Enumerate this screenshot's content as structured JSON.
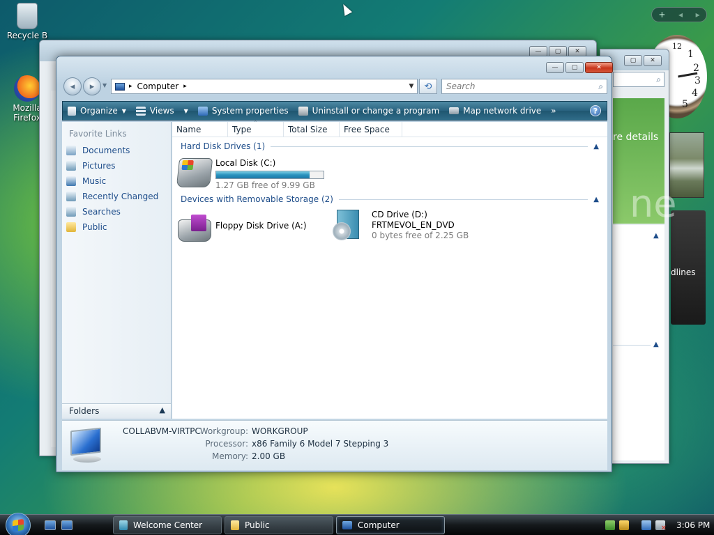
{
  "desktop": {
    "icons": [
      {
        "label": "Recycle B"
      },
      {
        "label": "Mozilla Firefox"
      }
    ]
  },
  "gadgets": {
    "controls": [
      "+",
      "◂",
      "▸"
    ],
    "clock_numbers": [
      "12",
      "1",
      "2",
      "3",
      "4",
      "5"
    ],
    "bg_texts": [
      "re details",
      "dlines",
      "ne"
    ]
  },
  "explorer": {
    "caption_buttons": {
      "minimize": "—",
      "maximize": "▢",
      "close": "✕"
    },
    "address": {
      "location": "Computer",
      "separator": "▸"
    },
    "search": {
      "placeholder": "Search",
      "icon": "search-icon"
    },
    "toolbar": [
      {
        "label": "Organize",
        "has_arrow": true
      },
      {
        "label": "Views",
        "has_arrow": true
      },
      {
        "label": "System properties"
      },
      {
        "label": "Uninstall or change a program"
      },
      {
        "label": "Map network drive"
      },
      {
        "label": "»"
      }
    ],
    "help": "?",
    "nav_pane": {
      "header": "Favorite Links",
      "links": [
        "Documents",
        "Pictures",
        "Music",
        "Recently Changed",
        "Searches",
        "Public"
      ],
      "folders_label": "Folders"
    },
    "columns": [
      "Name",
      "Type",
      "Total Size",
      "Free Space"
    ],
    "groups": [
      {
        "title": "Hard Disk Drives (1)",
        "drives": [
          {
            "name": "Local Disk (C:)",
            "free_text": "1.27 GB free of 9.99 GB",
            "used_fraction": 0.873
          }
        ]
      },
      {
        "title": "Devices with Removable Storage (2)",
        "drives": [
          {
            "name": "Floppy Disk Drive (A:)"
          },
          {
            "name": "CD Drive (D:)",
            "label": "FRTMEVOL_EN_DVD",
            "free_text": "0 bytes free of 2.25 GB"
          }
        ]
      }
    ],
    "details": {
      "computer_name": "COLLABVM-VIRTPC",
      "workgroup_label": "Workgroup:",
      "workgroup": "WORKGROUP",
      "processor_label": "Processor:",
      "processor": "x86 Family 6 Model 7 Stepping 3",
      "memory_label": "Memory:",
      "memory": "2.00 GB"
    }
  },
  "taskbar": {
    "tasks": [
      {
        "label": "Welcome Center"
      },
      {
        "label": "Public"
      },
      {
        "label": "Computer"
      }
    ],
    "time": "3:06 PM"
  }
}
